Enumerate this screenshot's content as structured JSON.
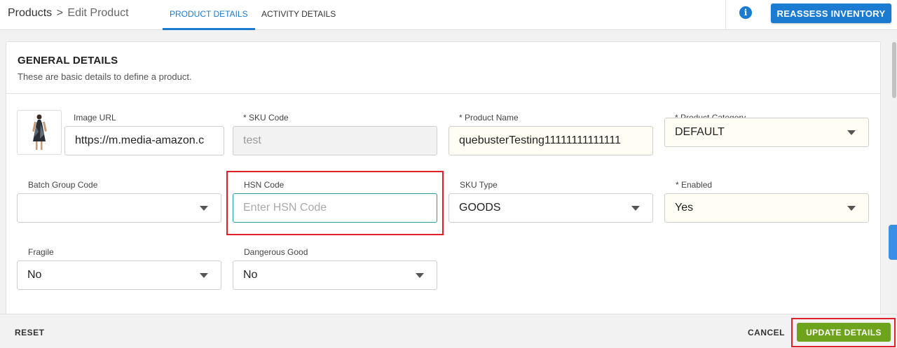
{
  "header": {
    "breadcrumb_root": "Products",
    "breadcrumb_separator": ">",
    "breadcrumb_current": "Edit Product",
    "tabs": [
      {
        "label": "PRODUCT DETAILS",
        "active": true
      },
      {
        "label": "ACTIVITY DETAILS",
        "active": false
      }
    ],
    "info_icon": "i",
    "reassess_label": "REASSESS INVENTORY"
  },
  "card": {
    "title": "GENERAL DETAILS",
    "subtitle": "These are basic details to define a product."
  },
  "fields": {
    "image_url": {
      "label": "Image URL",
      "value": "https://m.media-amazon.c"
    },
    "sku_code": {
      "label": "* SKU Code",
      "value": "test"
    },
    "product_name": {
      "label": "* Product Name",
      "value": "quebusterTesting11111111111111"
    },
    "product_category": {
      "label": "* Product Category",
      "value": "DEFAULT"
    },
    "batch_group_code": {
      "label": "Batch Group Code",
      "value": ""
    },
    "hsn_code": {
      "label": "HSN Code",
      "value": "",
      "placeholder": "Enter HSN Code"
    },
    "sku_type": {
      "label": "SKU Type",
      "value": "GOODS"
    },
    "enabled": {
      "label": "* Enabled",
      "value": "Yes"
    },
    "fragile": {
      "label": "Fragile",
      "value": "No"
    },
    "dangerous_good": {
      "label": "Dangerous Good",
      "value": "No"
    }
  },
  "footer": {
    "reset_label": "RESET",
    "cancel_label": "CANCEL",
    "update_label": "UPDATE DETAILS"
  },
  "colors": {
    "primary": "#1a7bd0",
    "update_button": "#6ea31c",
    "highlight": "#e0202a"
  }
}
